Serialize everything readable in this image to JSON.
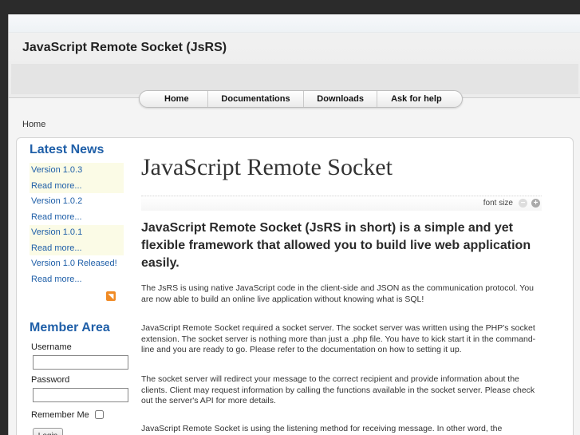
{
  "site": {
    "title": "JavaScript Remote Socket (JsRS)"
  },
  "nav": {
    "items": [
      "Home",
      "Documentations",
      "Downloads",
      "Ask for help"
    ]
  },
  "breadcrumb": "Home",
  "sidebar": {
    "news_heading": "Latest News",
    "news": [
      {
        "title": "Version 1.0.3",
        "more": "Read more..."
      },
      {
        "title": "Version 1.0.2",
        "more": "Read more..."
      },
      {
        "title": "Version 1.0.1",
        "more": "Read more..."
      },
      {
        "title": "Version 1.0 Released!",
        "more": "Read more..."
      }
    ],
    "member_heading": "Member Area",
    "username_label": "Username",
    "password_label": "Password",
    "remember_label": "Remember Me",
    "login_label": "Login"
  },
  "article": {
    "title": "JavaScript Remote Socket",
    "font_size_label": "font size",
    "lead": "JavaScript Remote Socket (JsRS in short) is a simple and yet flexible framework that allowed you to build live web application easily.",
    "paragraphs": [
      "The JsRS is using native JavaScript code in the client-side and JSON as the communication protocol. You are now able to build an online live application without knowing what is SQL!",
      "JavaScript Remote Socket required a socket server. The socket server was written using the PHP's socket extension. The socket server is nothing more than just a .php file. You have to kick start it in the command-line and you are ready to go. Please refer to the documentation on how to setting it up.",
      "The socket server will redirect your message to the correct recipient and provide information about the clients. Client may request information by calling the functions available in the socket server. Please check out the server's API for more details.",
      "JavaScript Remote Socket is using the listening method for receiving message. In other word, the"
    ]
  },
  "colors": {
    "link": "#1f5fa8",
    "news_bg": "#fbfbe6",
    "rss": "#f08a24"
  }
}
